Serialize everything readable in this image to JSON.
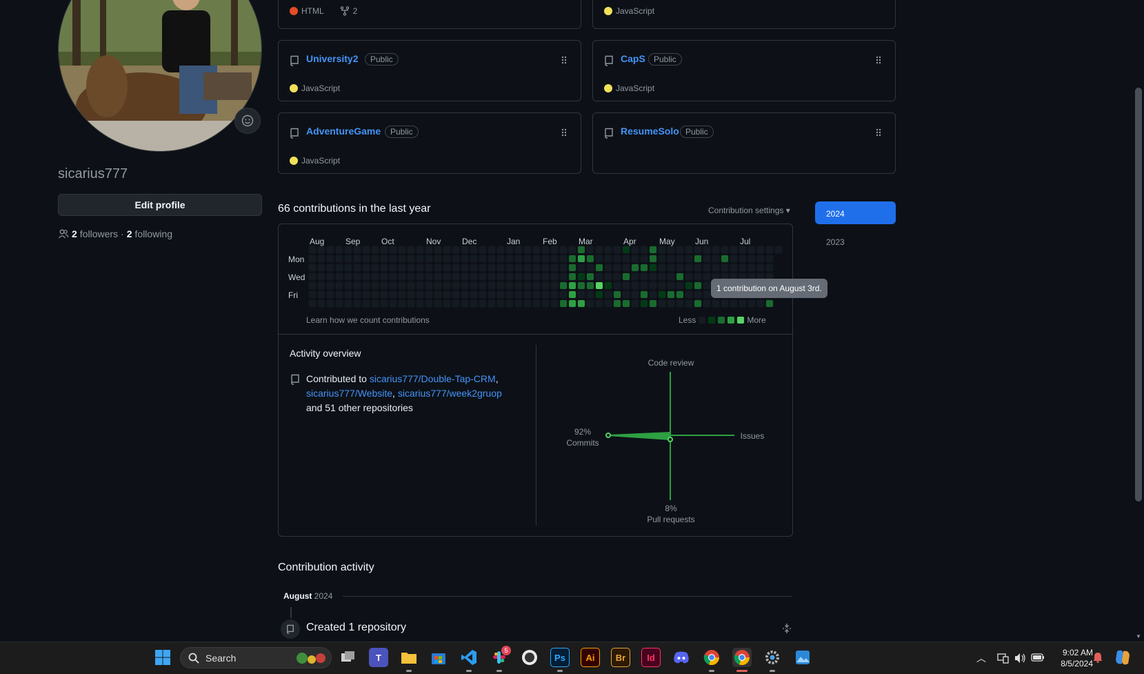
{
  "profile": {
    "username": "sicarius777",
    "edit_label": "Edit profile",
    "followers_count": "2",
    "followers_label": "followers",
    "separator": "·",
    "following_count": "2",
    "following_label": "following"
  },
  "repos": {
    "top_left": {
      "lang": "HTML",
      "lang_color": "#e34c26",
      "forks": "2"
    },
    "top_right": {
      "lang": "JavaScript",
      "lang_color": "#f1e05a"
    },
    "items": [
      {
        "name": "University2",
        "badge": "Public",
        "lang": "JavaScript",
        "lang_color": "#f1e05a"
      },
      {
        "name": "CapS",
        "badge": "Public",
        "lang": "JavaScript",
        "lang_color": "#f1e05a"
      },
      {
        "name": "AdventureGame",
        "badge": "Public",
        "lang": "JavaScript",
        "lang_color": "#f1e05a"
      },
      {
        "name": "ResumeSolo",
        "badge": "Public",
        "lang": "",
        "lang_color": ""
      }
    ]
  },
  "contributions": {
    "title": "66 contributions in the last year",
    "settings_label": "Contribution settings ▾",
    "months": [
      "Aug",
      "Sep",
      "Oct",
      "Nov",
      "Dec",
      "Jan",
      "Feb",
      "Mar",
      "Apr",
      "May",
      "Jun",
      "Jul"
    ],
    "days": [
      "Mon",
      "Wed",
      "Fri"
    ],
    "learn_label": "Learn how we count contributions",
    "legend_less": "Less",
    "legend_more": "More",
    "legend_colors": [
      "#151b23",
      "#033a16",
      "#196c2e",
      "#2ea043",
      "#56d364"
    ],
    "tooltip": "1 contribution on August 3rd.",
    "active_cells": [
      {
        "week": 29,
        "day": 1,
        "level": 2
      },
      {
        "week": 29,
        "day": 2,
        "level": 2
      },
      {
        "week": 29,
        "day": 3,
        "level": 2
      },
      {
        "week": 28,
        "day": 4,
        "level": 2
      },
      {
        "week": 29,
        "day": 4,
        "level": 3
      },
      {
        "week": 29,
        "day": 5,
        "level": 3
      },
      {
        "week": 28,
        "day": 6,
        "level": 2
      },
      {
        "week": 29,
        "day": 6,
        "level": 3
      },
      {
        "week": 30,
        "day": 6,
        "level": 3
      },
      {
        "week": 30,
        "day": 1,
        "level": 3
      },
      {
        "week": 31,
        "day": 1,
        "level": 2
      },
      {
        "week": 30,
        "day": 0,
        "level": 2
      },
      {
        "week": 30,
        "day": 3,
        "level": 1
      },
      {
        "week": 30,
        "day": 4,
        "level": 2
      },
      {
        "week": 31,
        "day": 4,
        "level": 2
      },
      {
        "week": 31,
        "day": 3,
        "level": 2
      },
      {
        "week": 32,
        "day": 2,
        "level": 2
      },
      {
        "week": 32,
        "day": 4,
        "level": 4
      },
      {
        "week": 32,
        "day": 5,
        "level": 1
      },
      {
        "week": 33,
        "day": 4,
        "level": 1
      },
      {
        "week": 34,
        "day": 5,
        "level": 2
      },
      {
        "week": 34,
        "day": 6,
        "level": 2
      },
      {
        "week": 35,
        "day": 3,
        "level": 2
      },
      {
        "week": 35,
        "day": 6,
        "level": 2
      },
      {
        "week": 35,
        "day": 0,
        "level": 1
      },
      {
        "week": 36,
        "day": 2,
        "level": 2
      },
      {
        "week": 37,
        "day": 2,
        "level": 2
      },
      {
        "week": 37,
        "day": 5,
        "level": 2
      },
      {
        "week": 37,
        "day": 6,
        "level": 1
      },
      {
        "week": 38,
        "day": 0,
        "level": 2
      },
      {
        "week": 38,
        "day": 1,
        "level": 2
      },
      {
        "week": 38,
        "day": 2,
        "level": 1
      },
      {
        "week": 38,
        "day": 6,
        "level": 2
      },
      {
        "week": 39,
        "day": 5,
        "level": 1
      },
      {
        "week": 40,
        "day": 5,
        "level": 2
      },
      {
        "week": 41,
        "day": 5,
        "level": 2
      },
      {
        "week": 41,
        "day": 3,
        "level": 2
      },
      {
        "week": 42,
        "day": 4,
        "level": 1
      },
      {
        "week": 43,
        "day": 1,
        "level": 2
      },
      {
        "week": 43,
        "day": 4,
        "level": 2
      },
      {
        "week": 43,
        "day": 6,
        "level": 2
      },
      {
        "week": 46,
        "day": 1,
        "level": 2
      },
      {
        "week": 51,
        "day": 6,
        "level": 2
      }
    ]
  },
  "years": {
    "selected": "2024",
    "other": "2023"
  },
  "activity": {
    "title": "Activity overview",
    "prefix": "Contributed to",
    "repo1": "sicarius777/Double-Tap-CRM",
    "comma1": ",",
    "repo2": "sicarius777/Website",
    "comma2": ",",
    "repo3": "sicarius777/week2gruop",
    "suffix": "and 51 other repositories",
    "radar": {
      "code_review": "Code review",
      "issues": "Issues",
      "commits_pct": "92%",
      "commits": "Commits",
      "pr_pct": "8%",
      "pull_requests": "Pull requests"
    }
  },
  "contribution_activity": {
    "title": "Contribution activity",
    "month": "August",
    "year": "2024",
    "created": "Created 1 repository"
  },
  "taskbar": {
    "search_label": "Search",
    "slack_badge": "5",
    "time": "9:02 AM",
    "date": "8/5/2024",
    "apps": [
      "windows-start",
      "task-view",
      "teams",
      "file-explorer",
      "microsoft-store",
      "vscode",
      "slack",
      "github-desktop",
      "photoshop",
      "illustrator",
      "bridge",
      "indesign",
      "discord",
      "chrome",
      "chrome-active",
      "settings",
      "photos"
    ],
    "ps_label": "Ps",
    "ai_label": "Ai",
    "br_label": "Br",
    "id_label": "Id"
  }
}
